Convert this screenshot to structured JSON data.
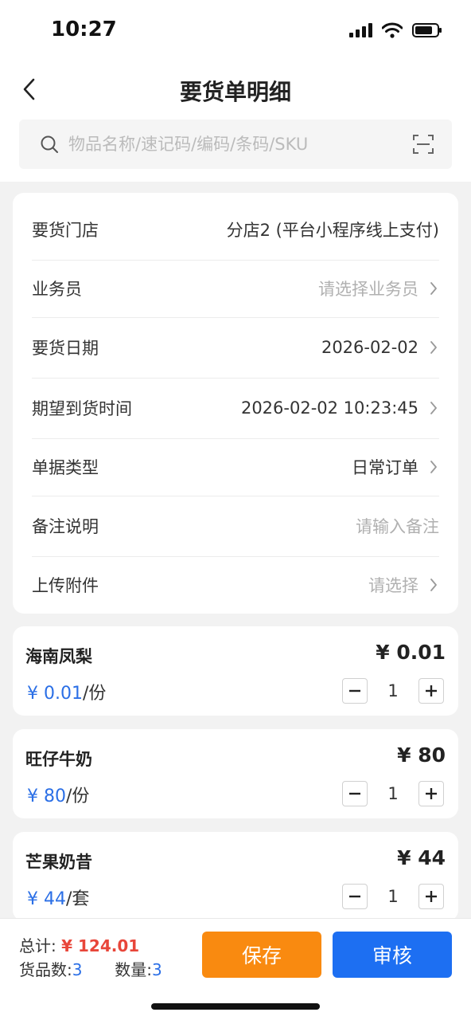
{
  "status_bar": {
    "time": "10:27"
  },
  "nav": {
    "title": "要货单明细"
  },
  "search": {
    "placeholder": "物品名称/速记码/编码/条码/SKU"
  },
  "info": {
    "rows": [
      {
        "label": "要货门店",
        "value": "分店2 (平台小程序线上支付)",
        "placeholder": false,
        "chevron": false
      },
      {
        "label": "业务员",
        "value": "请选择业务员",
        "placeholder": true,
        "chevron": true
      },
      {
        "label": "要货日期",
        "value": "2026-02-02",
        "placeholder": false,
        "chevron": true
      },
      {
        "label": "期望到货时间",
        "value": "2026-02-02 10:23:45",
        "placeholder": false,
        "chevron": true
      },
      {
        "label": "单据类型",
        "value": "日常订单",
        "placeholder": false,
        "chevron": true
      },
      {
        "label": "备注说明",
        "value": "请输入备注",
        "placeholder": true,
        "chevron": false
      },
      {
        "label": "上传附件",
        "value": "请选择",
        "placeholder": true,
        "chevron": true
      }
    ]
  },
  "products": [
    {
      "name": "海南凤梨",
      "total": "¥ 0.01",
      "price": "¥ 0.01",
      "unit": "/份",
      "qty": "1"
    },
    {
      "name": "旺仔牛奶",
      "total": "¥ 80",
      "price": "¥ 80",
      "unit": "/份",
      "qty": "1"
    },
    {
      "name": "芒果奶昔",
      "total": "¥ 44",
      "price": "¥ 44",
      "unit": "/套",
      "qty": "1"
    }
  ],
  "summary": {
    "total_label": "总计:",
    "total_amount": "¥ 124.01",
    "items_label": "货品数:",
    "items_count": "3",
    "qty_label": "数量:",
    "qty_count": "3"
  },
  "actions": {
    "save_label": "保存",
    "audit_label": "审核"
  },
  "colors": {
    "accent_blue": "#1d6ff2",
    "save_orange": "#f98a10",
    "total_red": "#e8463a",
    "price_blue": "#2b6fe6"
  }
}
